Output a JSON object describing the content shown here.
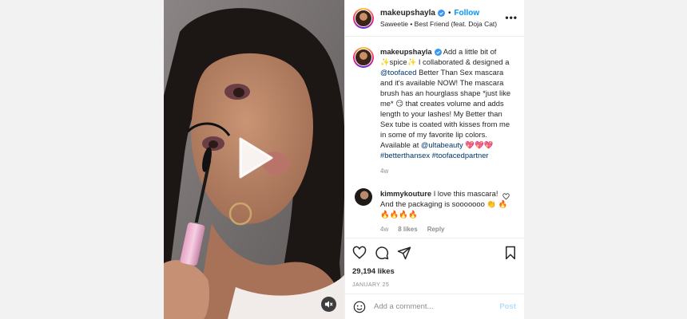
{
  "header": {
    "username": "makeupshayla",
    "follow_label": "Follow",
    "separator": "•",
    "music": "Saweetie • Best Friend (feat. Doja Cat)",
    "more": "•••"
  },
  "caption": {
    "username": "makeupshayla",
    "parts": [
      " Add a little bit of ✨spice✨ I collaborated & designed a ",
      "@toofaced",
      " Better Than Sex mascara and it's available NOW! The mascara brush has an hourglass shape *just like me* 😏 that creates volume and adds length to your lashes! My Better than Sex tube is coated with kisses from me in some of my favorite lip colors. Available at ",
      "@ultabeauty",
      " 💖💖💖 ",
      "#betterthansex",
      " ",
      "#toofacedpartner"
    ],
    "age": "4w"
  },
  "comment": {
    "username": "kimmykouture",
    "text": " I love this mascara! And the packaging is sooooooo 👏 🔥🔥🔥🔥🔥",
    "age": "4w",
    "likes": "8 likes",
    "reply": "Reply"
  },
  "post_footer": {
    "likes": "29,194 likes",
    "date": "JANUARY 25"
  },
  "add_comment": {
    "placeholder": "Add a comment...",
    "post_label": "Post"
  },
  "icons": {
    "verified": "verified-badge",
    "play": "play-icon",
    "mute": "muted-speaker-icon",
    "like": "heart-icon",
    "comment": "comment-icon",
    "share": "paper-plane-icon",
    "save": "bookmark-icon",
    "emoji": "smiley-icon"
  },
  "colors": {
    "link_blue": "#0095f6",
    "mention": "#00376b",
    "muted_text": "#8e8e8e"
  }
}
